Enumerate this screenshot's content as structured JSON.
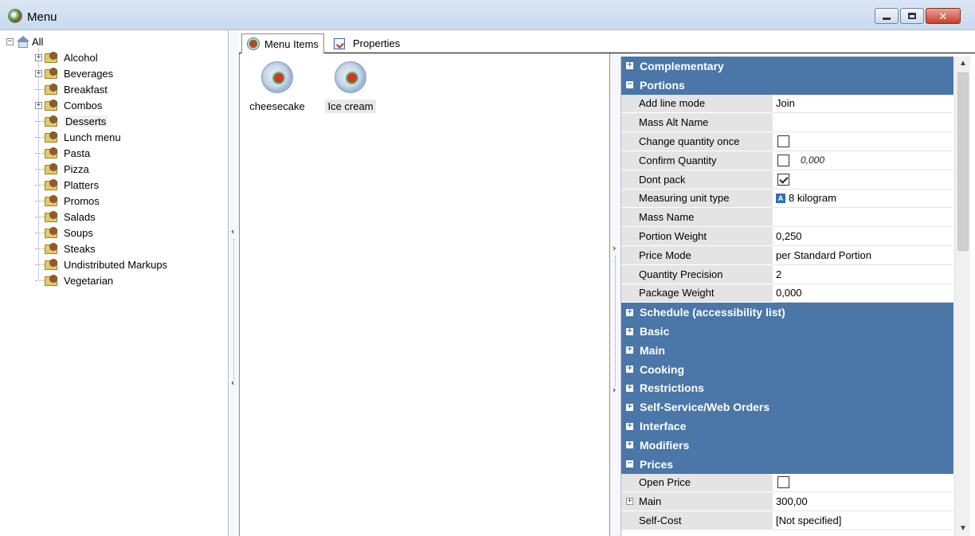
{
  "window": {
    "title": "Menu",
    "buttons": {
      "minimize": "—",
      "maximize": "□",
      "close": "✕"
    }
  },
  "tree": {
    "root": "All",
    "items": [
      {
        "label": "Alcohol",
        "expandable": true
      },
      {
        "label": "Beverages",
        "expandable": true
      },
      {
        "label": "Breakfast",
        "expandable": false
      },
      {
        "label": "Combos",
        "expandable": true
      },
      {
        "label": "Desserts",
        "expandable": false,
        "selected": true
      },
      {
        "label": "Lunch menu",
        "expandable": false
      },
      {
        "label": "Pasta",
        "expandable": false
      },
      {
        "label": "Pizza",
        "expandable": false
      },
      {
        "label": "Platters",
        "expandable": false
      },
      {
        "label": "Promos",
        "expandable": false
      },
      {
        "label": "Salads",
        "expandable": false
      },
      {
        "label": "Soups",
        "expandable": false
      },
      {
        "label": "Steaks",
        "expandable": false
      },
      {
        "label": "Undistributed Markups",
        "expandable": false
      },
      {
        "label": "Vegetarian",
        "expandable": false
      }
    ]
  },
  "tabs": [
    {
      "label": "Menu Items",
      "active": true
    },
    {
      "label": "Properties",
      "active": false
    }
  ],
  "menu_items": [
    {
      "label": "cheesecake",
      "selected": false
    },
    {
      "label": "Ice cream",
      "selected": true
    }
  ],
  "properties": {
    "categories": {
      "complementary": "Complementary",
      "portions": "Portions",
      "schedule": "Schedule (accessibility list)",
      "basic": "Basic",
      "main": "Main",
      "cooking": "Cooking",
      "restrictions": "Restrictions",
      "self_service": "Self-Service/Web Orders",
      "interface": "Interface",
      "modifiers": "Modifiers",
      "prices": "Prices"
    },
    "portions": {
      "add_line_mode": {
        "name": "Add line mode",
        "value": "Join"
      },
      "mass_alt_name": {
        "name": "Mass Alt Name",
        "value": ""
      },
      "change_quantity_once": {
        "name": "Change quantity once",
        "checked": false
      },
      "confirm_quantity": {
        "name": "Confirm Quantity",
        "checked": false,
        "extra": "0,000"
      },
      "dont_pack": {
        "name": "Dont pack",
        "checked": true
      },
      "measuring_unit_type": {
        "name": "Measuring unit type",
        "icon": "A",
        "value": "8 kilogram"
      },
      "mass_name": {
        "name": "Mass Name",
        "value": ""
      },
      "portion_weight": {
        "name": "Portion Weight",
        "value": "0,250"
      },
      "price_mode": {
        "name": "Price Mode",
        "value": "per Standard Portion"
      },
      "quantity_precision": {
        "name": "Quantity Precision",
        "value": "2"
      },
      "package_weight": {
        "name": "Package Weight",
        "value": "0,000"
      }
    },
    "prices": {
      "open_price": {
        "name": "Open Price",
        "checked": false
      },
      "main": {
        "name": "Main",
        "value": "300,00"
      },
      "self_cost": {
        "name": "Self-Cost",
        "value": "[Not specified]"
      }
    },
    "toggles": {
      "plus": "+",
      "minus": "−"
    }
  },
  "scrollbar": {
    "up": "▲",
    "down": "▼"
  },
  "splitters": {
    "left_arrow": "‹",
    "right_arrow": "›"
  }
}
